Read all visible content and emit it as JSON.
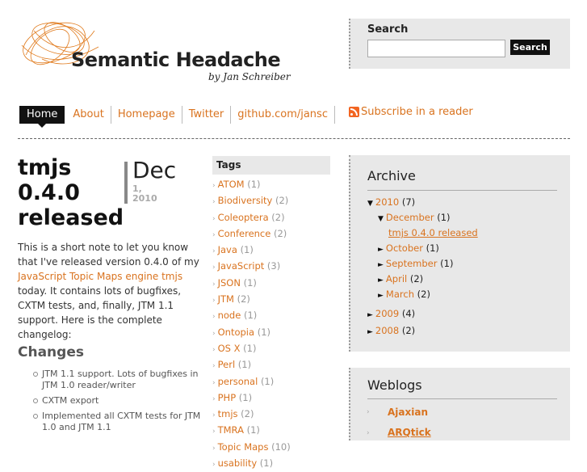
{
  "header": {
    "site_title": "Semantic Headache",
    "byline": "by Jan Schreiber"
  },
  "search": {
    "title": "Search",
    "button_label": "Search",
    "value": "",
    "placeholder": ""
  },
  "nav": {
    "items": [
      "Home",
      "About",
      "Homepage",
      "Twitter",
      "github.com/jansc"
    ],
    "subscribe_label": "Subscribe in a reader"
  },
  "post": {
    "title": "tmjs 0.4.0 released",
    "date_month": "Dec",
    "date_day": "1,",
    "date_year": "2010",
    "intro_before": "This is a short note to let you know that I've released version 0.4.0 of my ",
    "intro_link": "JavaScript Topic Maps engine tmjs",
    "intro_after": " today. It contains lots of bugfixes, CXTM tests, and, finally, JTM 1.1 support. Here is the complete changelog:",
    "changes_title": "Changes",
    "changes": [
      "JTM 1.1 support. Lots of bugfixes in JTM 1.0 reader/writer",
      "CXTM export",
      "Implemented all CXTM tests for JTM 1.0 and JTM 1.1"
    ]
  },
  "tags": {
    "title": "Tags",
    "items": [
      {
        "name": "ATOM",
        "count": "(1)"
      },
      {
        "name": "Biodiversity",
        "count": "(2)"
      },
      {
        "name": "Coleoptera",
        "count": "(2)"
      },
      {
        "name": "Conference",
        "count": "(2)"
      },
      {
        "name": "Java",
        "count": "(1)"
      },
      {
        "name": "JavaScript",
        "count": "(3)"
      },
      {
        "name": "JSON",
        "count": "(1)"
      },
      {
        "name": "JTM",
        "count": "(2)"
      },
      {
        "name": "node",
        "count": "(1)"
      },
      {
        "name": "Ontopia",
        "count": "(1)"
      },
      {
        "name": "OS X",
        "count": "(1)"
      },
      {
        "name": "Perl",
        "count": "(1)"
      },
      {
        "name": "personal",
        "count": "(1)"
      },
      {
        "name": "PHP",
        "count": "(1)"
      },
      {
        "name": "tmjs",
        "count": "(2)"
      },
      {
        "name": "TMRA",
        "count": "(1)"
      },
      {
        "name": "Topic Maps",
        "count": "(10)"
      },
      {
        "name": "usability",
        "count": "(1)"
      }
    ]
  },
  "archive": {
    "title": "Archive",
    "year_2010": {
      "label": "2010",
      "count": "(7)"
    },
    "december": {
      "label": "December",
      "count": "(1)"
    },
    "december_post": "tmjs 0.4.0 released",
    "october": {
      "label": "October",
      "count": "(1)"
    },
    "september": {
      "label": "September",
      "count": "(1)"
    },
    "april": {
      "label": "April",
      "count": "(2)"
    },
    "march": {
      "label": "March",
      "count": "(2)"
    },
    "year_2009": {
      "label": "2009",
      "count": "(4)"
    },
    "year_2008": {
      "label": "2008",
      "count": "(2)"
    }
  },
  "weblogs": {
    "title": "Weblogs",
    "items": [
      "Ajaxian",
      "ARQtick"
    ]
  },
  "colors": {
    "link": "#d9731f",
    "panel_bg": "#e8e8e8",
    "nav_active_bg": "#111111"
  }
}
